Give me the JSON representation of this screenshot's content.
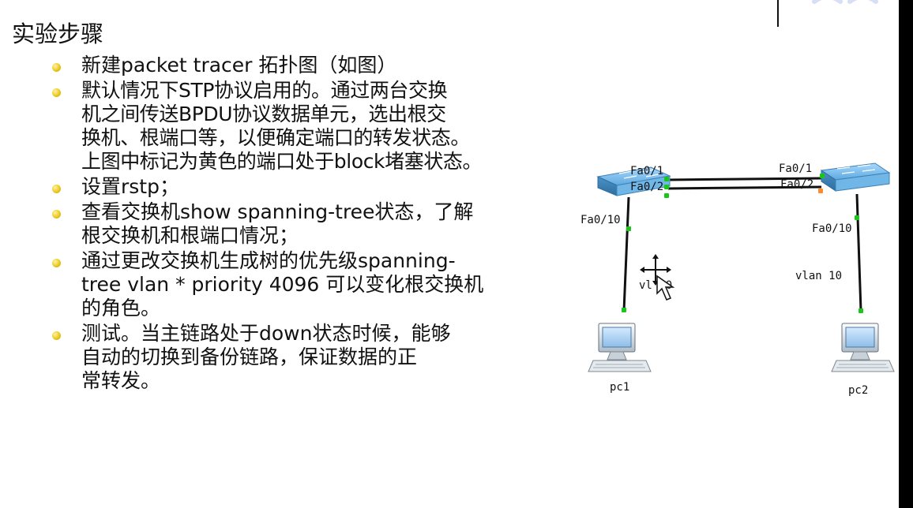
{
  "slide": {
    "title": "实验步骤",
    "bullets": [
      {
        "text": "新建packet tracer 拓扑图（如图）"
      },
      {
        "text": "默认情况下STP协议启用的。通过两台交换\n机之间传送BPDU协议数据单元，选出根交\n换机、根端口等，以便确定端口的转发状态。\n上图中标记为黄色的端口处于block堵塞状态。"
      },
      {
        "text": "设置rstp；"
      },
      {
        "text": "查看交换机show spanning-tree状态，了解\n根交换机和根端口情况；"
      },
      {
        "text": "通过更改交换机生成树的优先级spanning-\ntree vlan * priority 4096 可以变化根交换机\n的角色。"
      },
      {
        "text": "测试。当主链路处于down状态时候，能够\n自动的切换到备份链路，保证数据的正\n常转发。"
      }
    ]
  },
  "topology": {
    "labels": {
      "sw1_fa01": "Fa0/1",
      "sw1_fa02": "Fa0/2",
      "sw1_fa010": "Fa0/10",
      "sw2_fa01": "Fa0/1",
      "sw2_fa02": "Fa0/2",
      "sw2_fa010": "Fa0/10",
      "vlan_left": "vl  10",
      "vlan_right": "vlan 10",
      "pc1": "pc1",
      "pc2": "pc2"
    },
    "port_colors": {
      "forwarding": "#19c719",
      "blocked": "#ff8a2a"
    },
    "icons": {
      "switch": "switch-icon",
      "pc": "pc-icon",
      "cursor": "move-cursor-icon"
    }
  }
}
